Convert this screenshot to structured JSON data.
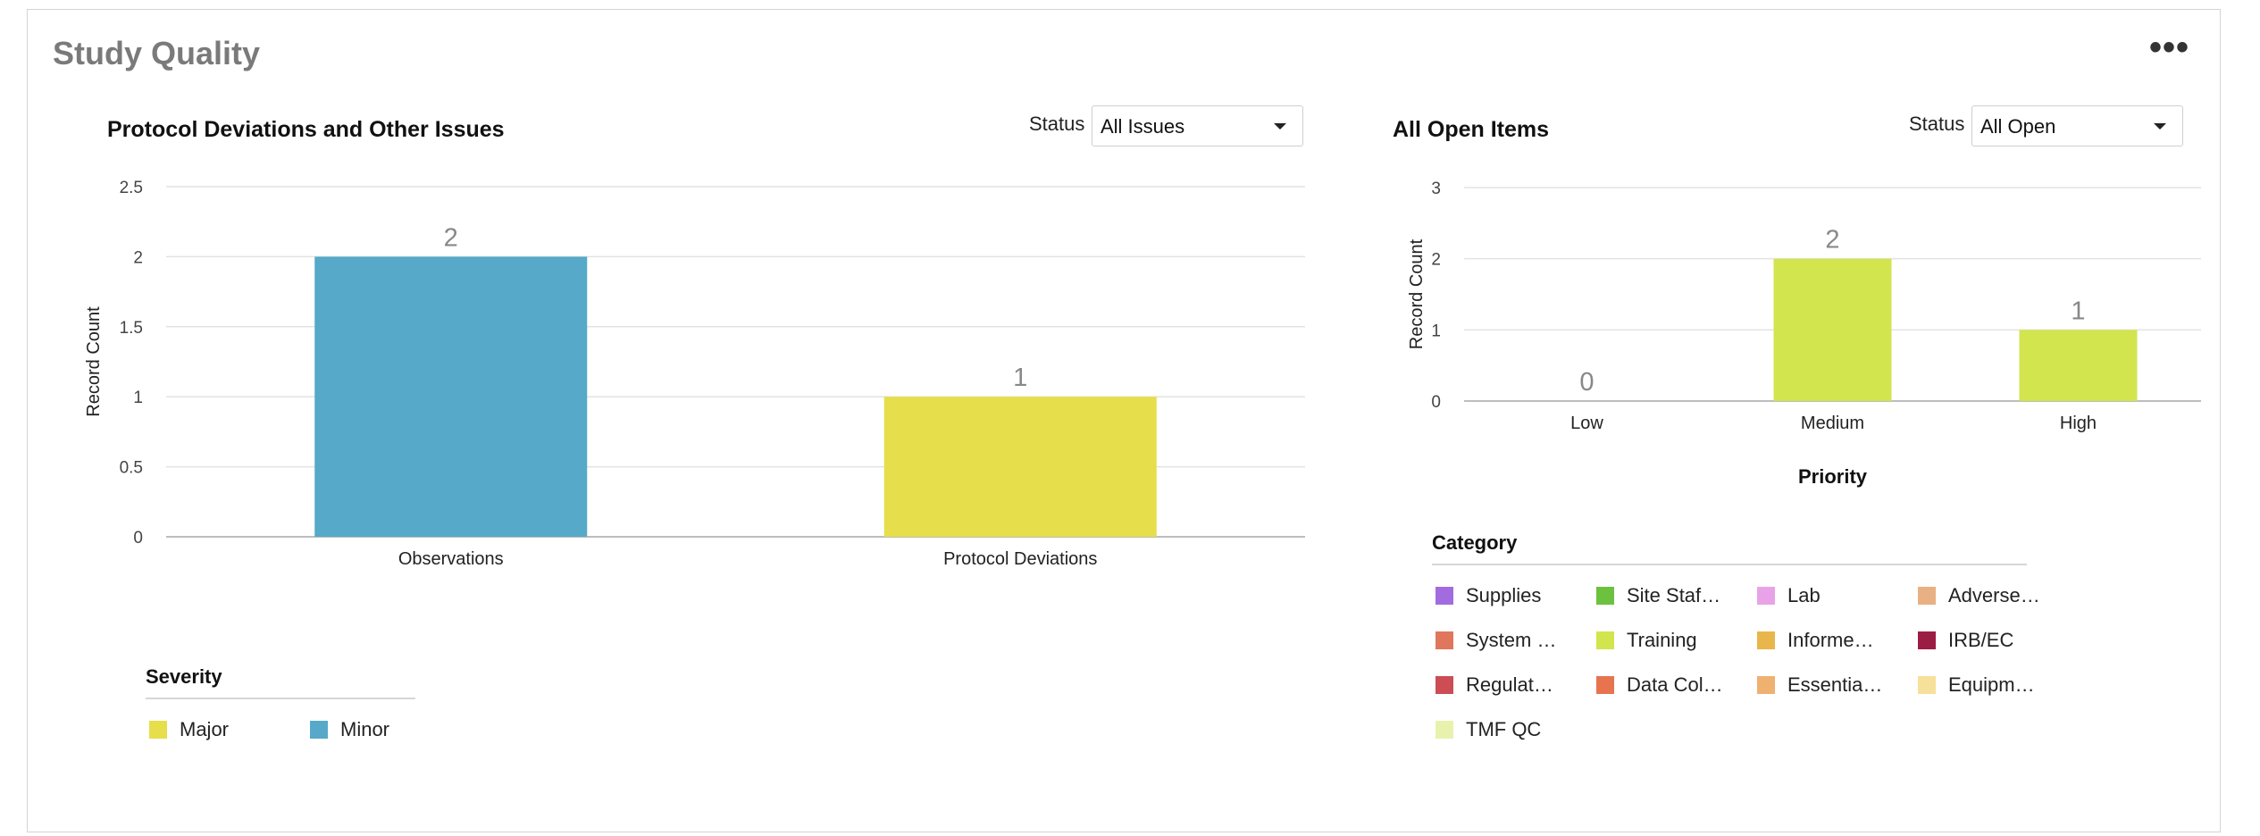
{
  "card": {
    "title": "Study Quality",
    "more_label": "•••"
  },
  "left": {
    "title": "Protocol Deviations and Other Issues",
    "status_label": "Status",
    "status_value": "All Issues",
    "chart_data": {
      "type": "bar",
      "title": "Protocol Deviations and Other Issues",
      "categories": [
        "Observations",
        "Protocol Deviations"
      ],
      "values": [
        2,
        1
      ],
      "bar_colors": [
        "#56a9c8",
        "#e6de4a"
      ],
      "ylabel": "Record Count",
      "xlabel": "",
      "ylim": [
        0,
        2.5
      ],
      "yticks": [
        0,
        0.5,
        1,
        1.5,
        2,
        2.5
      ],
      "ytick_labels": [
        "0",
        "0.5",
        "1",
        "1.5",
        "2",
        "2.5"
      ],
      "data_labels": [
        "2",
        "1"
      ],
      "grid": true,
      "legend_placement": "bottom-left"
    },
    "legend": {
      "title": "Severity",
      "items": [
        {
          "label": "Major",
          "color": "#e6de4a"
        },
        {
          "label": "Minor",
          "color": "#56a9c8"
        }
      ]
    }
  },
  "right": {
    "title": "All Open Items",
    "status_label": "Status",
    "status_value": "All Open",
    "chart_data": {
      "type": "bar",
      "title": "All Open Items",
      "categories": [
        "Low",
        "Medium",
        "High"
      ],
      "values": [
        0,
        2,
        1
      ],
      "bar_color": "#d2e54f",
      "ylabel": "Record Count",
      "xlabel": "Priority",
      "ylim": [
        0,
        3
      ],
      "yticks": [
        0,
        1,
        2,
        3
      ],
      "ytick_labels": [
        "0",
        "1",
        "2",
        "3"
      ],
      "data_labels": [
        "0",
        "2",
        "1"
      ],
      "grid": true,
      "legend_placement": "bottom-left"
    },
    "legend": {
      "title": "Category",
      "items": [
        {
          "label": "Supplies",
          "color": "#a36be0"
        },
        {
          "label": "Site Staf…",
          "color": "#6cc13f"
        },
        {
          "label": "Lab",
          "color": "#e8a3e8"
        },
        {
          "label": "Adverse…",
          "color": "#e9b083"
        },
        {
          "label": "System …",
          "color": "#e0775d"
        },
        {
          "label": "Training",
          "color": "#d2e54f"
        },
        {
          "label": "Informe…",
          "color": "#e8b64a"
        },
        {
          "label": "IRB/EC",
          "color": "#9c1d44"
        },
        {
          "label": "Regulat…",
          "color": "#cc4d53"
        },
        {
          "label": "Data Col…",
          "color": "#e8744f"
        },
        {
          "label": "Essentia…",
          "color": "#efb170"
        },
        {
          "label": "Equipm…",
          "color": "#f7e09a"
        },
        {
          "label": "TMF QC",
          "color": "#e9f2ad"
        }
      ]
    }
  }
}
